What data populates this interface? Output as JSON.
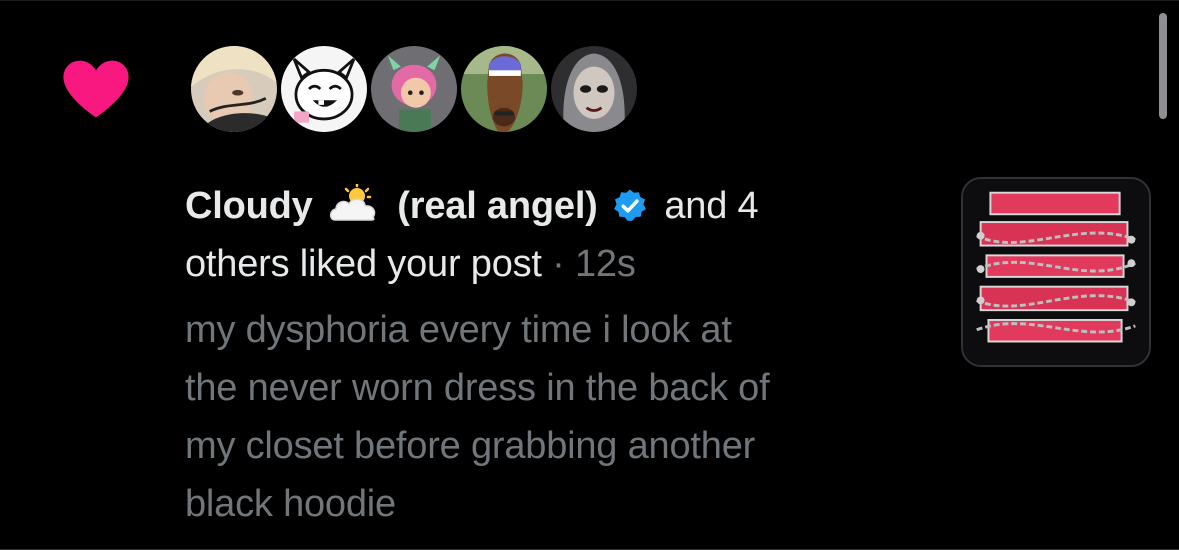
{
  "colors": {
    "background": "#000000",
    "heart": "#f91880",
    "primary_text": "#e7e9ea",
    "secondary_text": "#71767b",
    "verified": "#1d9bf0"
  },
  "icons": {
    "like": "heart-icon",
    "emoji": "sun-behind-cloud-emoji",
    "verified": "verified-badge-icon"
  },
  "notification": {
    "liker_name": "Cloudy",
    "liker_suffix": "(real angel)",
    "and_text": "and 4",
    "others_text": "others liked your post",
    "separator": "·",
    "time": "12s"
  },
  "post": {
    "text_lines": [
      "my dysphoria every time i look at",
      "the never worn dress in the back of",
      "my closet before grabbing another",
      "black hoodie"
    ]
  },
  "avatars": [
    {
      "id": "liker-1",
      "bg": "#cfc3b3"
    },
    {
      "id": "liker-2",
      "bg": "#f2f2f2"
    },
    {
      "id": "liker-3",
      "bg": "#6b6b70"
    },
    {
      "id": "liker-4",
      "bg": "#5f7a4a"
    },
    {
      "id": "liker-5",
      "bg": "#3a3a3c"
    }
  ]
}
